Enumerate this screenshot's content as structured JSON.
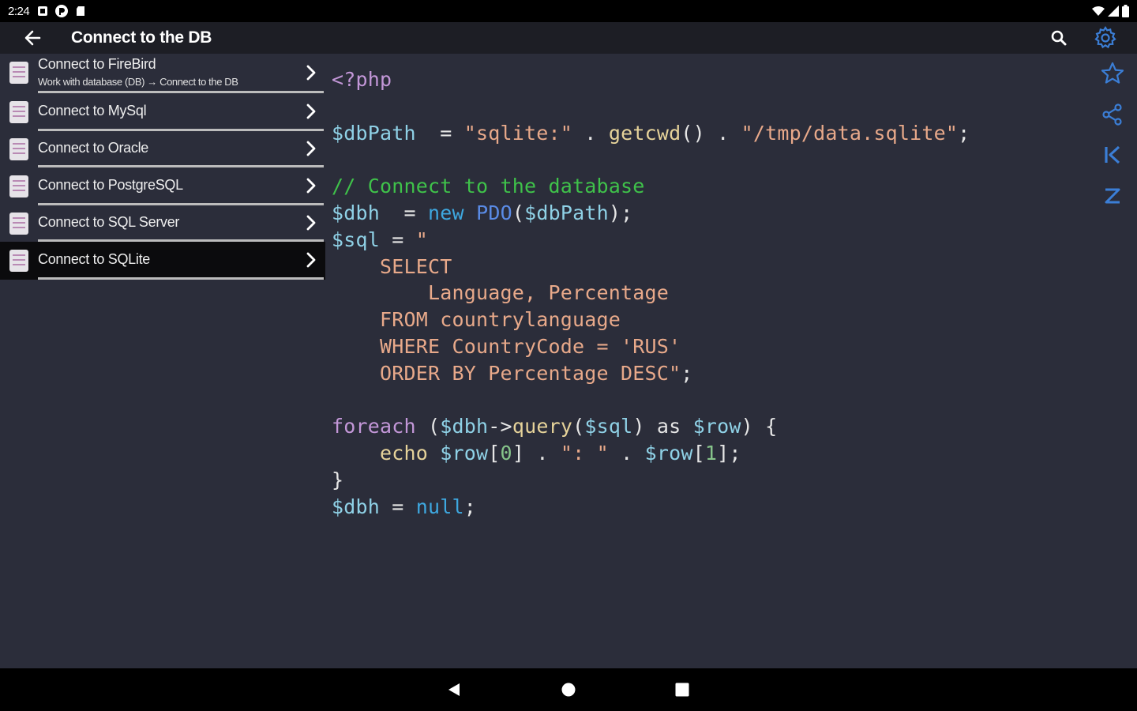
{
  "status_bar": {
    "time": "2:24"
  },
  "app_bar": {
    "title": "Connect to the DB",
    "accent": "#3b7ed6"
  },
  "sidebar": {
    "items": [
      {
        "label": "Connect to FireBird",
        "subtitle": "Work with database (DB) → Connect to the DB"
      },
      {
        "label": "Connect to MySql"
      },
      {
        "label": "Connect to Oracle"
      },
      {
        "label": "Connect to PostgreSQL"
      },
      {
        "label": "Connect to SQL Server"
      },
      {
        "label": "Connect to SQLite"
      }
    ],
    "selected": "Connect to SQLite"
  },
  "code": {
    "language": "php",
    "lines": [
      [
        {
          "t": "<?php",
          "c": "tag"
        }
      ],
      [],
      [
        {
          "t": "$dbPath",
          "c": "var"
        },
        {
          "t": "  = ",
          "c": "op"
        },
        {
          "t": "\"sqlite:\"",
          "c": "str"
        },
        {
          "t": " . ",
          "c": "op"
        },
        {
          "t": "getcwd",
          "c": "fn"
        },
        {
          "t": "() . ",
          "c": "op"
        },
        {
          "t": "\"/tmp/data.sqlite\"",
          "c": "str"
        },
        {
          "t": ";",
          "c": "op"
        }
      ],
      [],
      [
        {
          "t": "// Connect to the database",
          "c": "com"
        }
      ],
      [
        {
          "t": "$dbh",
          "c": "var"
        },
        {
          "t": "  = ",
          "c": "op"
        },
        {
          "t": "new",
          "c": "kw"
        },
        {
          "t": " ",
          "c": "op"
        },
        {
          "t": "PDO",
          "c": "cls"
        },
        {
          "t": "(",
          "c": "op"
        },
        {
          "t": "$dbPath",
          "c": "var"
        },
        {
          "t": ");",
          "c": "op"
        }
      ],
      [
        {
          "t": "$sql",
          "c": "var"
        },
        {
          "t": " = ",
          "c": "op"
        },
        {
          "t": "\"",
          "c": "str"
        }
      ],
      [
        {
          "t": "    SELECT",
          "c": "str"
        }
      ],
      [
        {
          "t": "        Language, Percentage",
          "c": "str"
        }
      ],
      [
        {
          "t": "    FROM countrylanguage",
          "c": "str"
        }
      ],
      [
        {
          "t": "    WHERE CountryCode = 'RUS'",
          "c": "str"
        }
      ],
      [
        {
          "t": "    ORDER BY Percentage DESC\"",
          "c": "str"
        },
        {
          "t": ";",
          "c": "op"
        }
      ],
      [],
      [
        {
          "t": "foreach",
          "c": "for"
        },
        {
          "t": " (",
          "c": "op"
        },
        {
          "t": "$dbh",
          "c": "var"
        },
        {
          "t": "->",
          "c": "op"
        },
        {
          "t": "query",
          "c": "fn"
        },
        {
          "t": "(",
          "c": "op"
        },
        {
          "t": "$sql",
          "c": "var"
        },
        {
          "t": ") as ",
          "c": "op"
        },
        {
          "t": "$row",
          "c": "var"
        },
        {
          "t": ") {",
          "c": "op"
        }
      ],
      [
        {
          "t": "    echo ",
          "c": "fn"
        },
        {
          "t": "$row",
          "c": "var"
        },
        {
          "t": "[",
          "c": "op"
        },
        {
          "t": "0",
          "c": "num"
        },
        {
          "t": "] . ",
          "c": "op"
        },
        {
          "t": "\": \"",
          "c": "str"
        },
        {
          "t": " . ",
          "c": "op"
        },
        {
          "t": "$row",
          "c": "var"
        },
        {
          "t": "[",
          "c": "op"
        },
        {
          "t": "1",
          "c": "num"
        },
        {
          "t": "];",
          "c": "op"
        }
      ],
      [
        {
          "t": "}",
          "c": "op"
        }
      ],
      [
        {
          "t": "$dbh",
          "c": "var"
        },
        {
          "t": " = ",
          "c": "op"
        },
        {
          "t": "null",
          "c": "null"
        },
        {
          "t": ";",
          "c": "op"
        }
      ]
    ]
  },
  "right_toolbar": [
    "star-icon",
    "share-icon",
    "first-page-icon",
    "last-page-icon"
  ],
  "nav_bar": [
    "back-triangle-icon",
    "home-circle-icon",
    "recents-square-icon"
  ]
}
